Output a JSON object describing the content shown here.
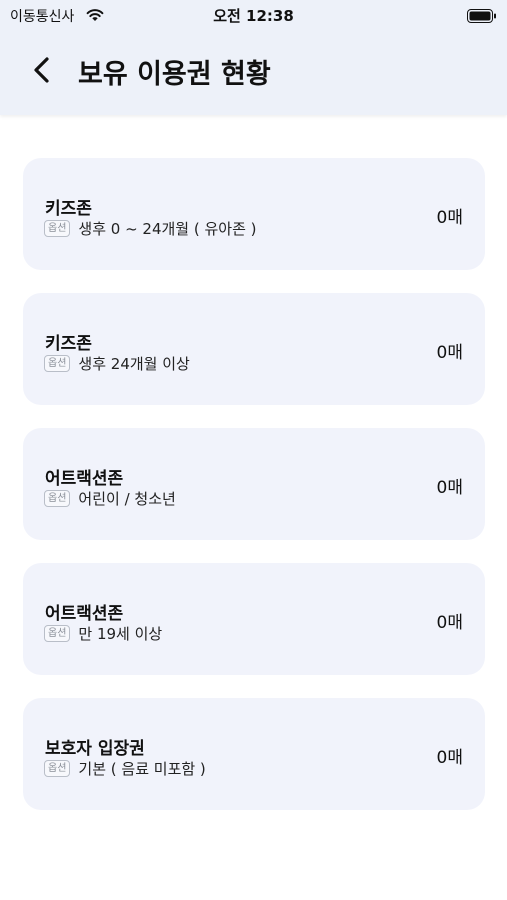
{
  "status_bar": {
    "carrier": "이동통신사",
    "time": "오전 12:38"
  },
  "header": {
    "title": "보유 이용권 현황"
  },
  "tickets": [
    {
      "title": "키즈존",
      "option_badge": "옵션",
      "option_text": "생후 0 ~ 24개월 ( 유아존 )",
      "count": "0매"
    },
    {
      "title": "키즈존",
      "option_badge": "옵션",
      "option_text": "생후 24개월 이상",
      "count": "0매"
    },
    {
      "title": "어트랙션존",
      "option_badge": "옵션",
      "option_text": "어린이 / 청소년",
      "count": "0매"
    },
    {
      "title": "어트랙션존",
      "option_badge": "옵션",
      "option_text": "만 19세 이상",
      "count": "0매"
    },
    {
      "title": "보호자 입장권",
      "option_badge": "옵션",
      "option_text": "기본 ( 음료 미포함 )",
      "count": "0매"
    }
  ]
}
